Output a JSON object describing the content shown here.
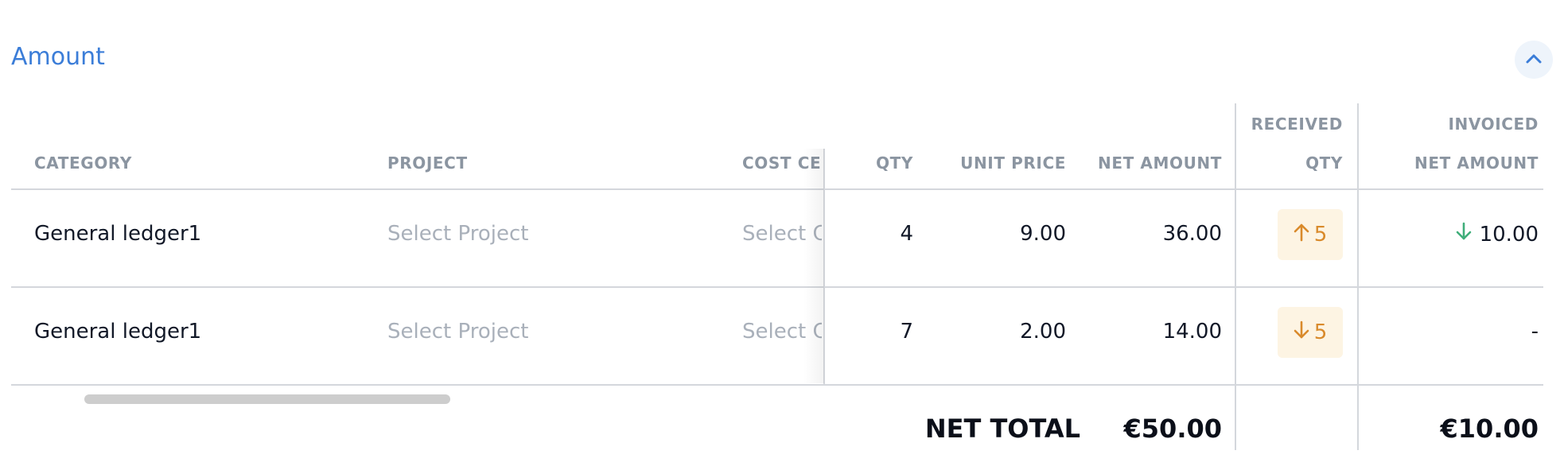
{
  "section": {
    "title": "Amount"
  },
  "columns": {
    "category": "CATEGORY",
    "project": "PROJECT",
    "cost_center": "COST CE",
    "qty": "QTY",
    "unit_price": "UNIT PRICE",
    "net_amount": "NET AMOUNT",
    "received_top": "RECEIVED",
    "received_bottom": "QTY",
    "invoiced_top": "INVOICED",
    "invoiced_bottom": "NET AMOUNT"
  },
  "rows": [
    {
      "category": "General ledger1",
      "project_placeholder": "Select Project",
      "cost_center_placeholder": "Select C",
      "qty": "4",
      "unit_price": "9.00",
      "net_amount": "36.00",
      "received_direction": "up",
      "received_qty": "5",
      "invoiced_direction": "down",
      "invoiced_net_amount": "10.00"
    },
    {
      "category": "General ledger1",
      "project_placeholder": "Select Project",
      "cost_center_placeholder": "Select C",
      "qty": "7",
      "unit_price": "2.00",
      "net_amount": "14.00",
      "received_direction": "down",
      "received_qty": "5",
      "invoiced_direction": "none",
      "invoiced_net_amount": "-"
    }
  ],
  "totals": {
    "label": "NET TOTAL",
    "net_amount": "€50.00",
    "invoiced_net_amount": "€10.00"
  },
  "colors": {
    "accent": "#3b7dd8",
    "badge_bg": "#fdf4e3",
    "badge_fg": "#d98a2b",
    "down_green": "#3fae7a"
  },
  "icons": {
    "collapse": "chevron-up-icon",
    "received_up": "arrow-up-icon",
    "received_down": "arrow-down-icon",
    "invoiced_down": "arrow-down-icon"
  }
}
